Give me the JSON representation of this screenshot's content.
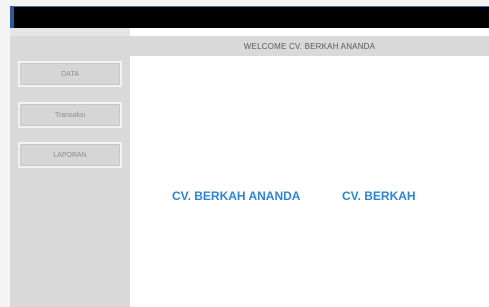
{
  "header": {
    "welcome_text": "WELCOME  CV. BERKAH ANANDA"
  },
  "sidebar": {
    "items": [
      {
        "label": "DATA"
      },
      {
        "label": "Transaksi"
      },
      {
        "label": "LAPORAN"
      }
    ]
  },
  "main": {
    "brand_primary": "CV. BERKAH ANANDA",
    "brand_secondary": "CV. BERKAH"
  },
  "colors": {
    "titlebar": "#000000",
    "sidebar": "#d9d9d9",
    "header_strip": "#d9d9d9",
    "brand_text": "#2e86d0"
  }
}
